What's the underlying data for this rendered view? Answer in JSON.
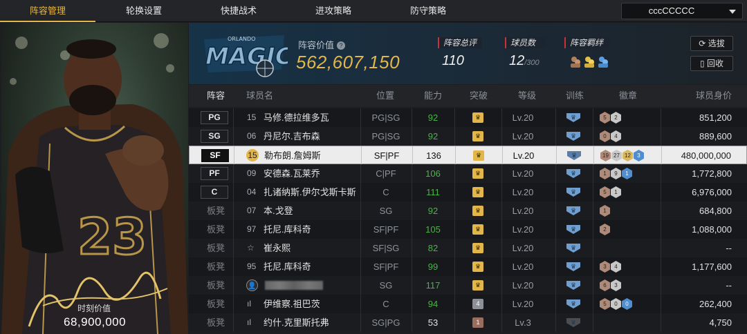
{
  "nav": {
    "tabs": [
      "阵容管理",
      "轮换设置",
      "快捷战术",
      "进攻策略",
      "防守策略"
    ],
    "active_index": 0,
    "lineup_select": "cccCCCCC"
  },
  "card": {
    "jersey_number": "23",
    "value_label": "时刻价值",
    "value": "68,900,000"
  },
  "header": {
    "team_logo": "magic-logo",
    "lineup_value_label": "阵容价值",
    "lineup_value": "562,607,150",
    "total_rating_label": "阵容总评",
    "total_rating": "110",
    "player_count_label": "球员数",
    "player_count": "12",
    "player_count_max": "/300",
    "chemistry_label": "阵容羁绊",
    "select_button": "选拔",
    "recycle_button": "回收"
  },
  "table": {
    "headers": [
      "阵容",
      "球员名",
      "位置",
      "能力",
      "突破",
      "等级",
      "训练",
      "徽章",
      "球员身价"
    ],
    "rows": [
      {
        "slot": "PG",
        "starter": true,
        "num": "15",
        "name": "马修.德拉维多瓦",
        "position": "PG|SG",
        "rating": "92",
        "rating_color": "#4cb34c",
        "break": "crown",
        "break_color": "#e3b64a",
        "level": "Lv.20",
        "badges": [
          [
            "5",
            "b-bronze"
          ],
          [
            "2",
            "b-silver"
          ]
        ],
        "value": "851,200"
      },
      {
        "slot": "SG",
        "starter": true,
        "num": "06",
        "name": "丹尼尔.吉布森",
        "position": "PG|SG",
        "rating": "92",
        "rating_color": "#4cb34c",
        "break": "crown",
        "break_color": "#e3b64a",
        "level": "Lv.20",
        "badges": [
          [
            "0",
            "b-bronze"
          ],
          [
            "4",
            "b-silver"
          ]
        ],
        "value": "889,600"
      },
      {
        "slot": "SF",
        "starter": true,
        "selected": true,
        "num": "15",
        "name": "勒布朗.詹姆斯",
        "position": "SF|PF",
        "rating": "136",
        "rating_color": "#111111",
        "break": "crown",
        "break_color": "#e3b64a",
        "level": "Lv.20",
        "badges": [
          [
            "19",
            "b-bronze"
          ],
          [
            "27",
            "b-silver"
          ],
          [
            "12",
            "b-gold"
          ],
          [
            "3",
            "b-blue"
          ]
        ],
        "value": "480,000,000"
      },
      {
        "slot": "PF",
        "starter": true,
        "num": "09",
        "name": "安德森.瓦莱乔",
        "position": "C|PF",
        "rating": "106",
        "rating_color": "#4cb34c",
        "break": "crown",
        "break_color": "#e3b64a",
        "level": "Lv.20",
        "badges": [
          [
            "1",
            "b-bronze"
          ],
          [
            "9",
            "b-silver"
          ],
          [
            "1",
            "b-blue"
          ]
        ],
        "value": "1,772,800"
      },
      {
        "slot": "C",
        "starter": true,
        "num": "04",
        "name": "扎诸纳斯.伊尔戈斯卡斯",
        "position": "C",
        "rating": "111",
        "rating_color": "#4cb34c",
        "break": "crown",
        "break_color": "#e3b64a",
        "level": "Lv.20",
        "badges": [
          [
            "5",
            "b-bronze"
          ],
          [
            "1",
            "b-silver"
          ]
        ],
        "value": "6,976,000"
      },
      {
        "slot": "板凳",
        "starter": false,
        "num": "07",
        "name": "本.戈登",
        "position": "SG",
        "rating": "92",
        "rating_color": "#4cb34c",
        "break": "crown",
        "break_color": "#e3b64a",
        "level": "Lv.20",
        "badges": [
          [
            "1",
            "b-bronze"
          ]
        ],
        "value": "684,800"
      },
      {
        "slot": "板凳",
        "starter": false,
        "num": "97",
        "name": "托尼.库科奇",
        "position": "SF|PF",
        "rating": "105",
        "rating_color": "#4cb34c",
        "break": "crown",
        "break_color": "#e3b64a",
        "level": "Lv.20",
        "badges": [
          [
            "2",
            "b-bronze"
          ]
        ],
        "value": "1,088,000"
      },
      {
        "slot": "板凳",
        "starter": false,
        "num": "☆",
        "name": "崔永熙",
        "position": "SF|SG",
        "rating": "82",
        "rating_color": "#4cb34c",
        "break": "crown",
        "break_color": "#e3b64a",
        "level": "Lv.20",
        "badges": [],
        "value": "--"
      },
      {
        "slot": "板凳",
        "starter": false,
        "num": "95",
        "name": "托尼.库科奇",
        "position": "SF|PF",
        "rating": "99",
        "rating_color": "#4cb34c",
        "break": "crown",
        "break_color": "#e3b64a",
        "level": "Lv.20",
        "badges": [
          [
            "3",
            "b-bronze"
          ],
          [
            "4",
            "b-silver"
          ]
        ],
        "value": "1,177,600"
      },
      {
        "slot": "板凳",
        "starter": false,
        "num": "",
        "name": "",
        "position": "SG",
        "rating": "117",
        "rating_color": "#4cb34c",
        "break": "crown",
        "break_color": "#e3b64a",
        "level": "Lv.20",
        "badges": [
          [
            "6",
            "b-bronze"
          ],
          [
            "3",
            "b-silver"
          ]
        ],
        "value": "--"
      },
      {
        "slot": "板凳",
        "starter": false,
        "num": "ıl",
        "name": "伊维察.祖巴茨",
        "position": "C",
        "rating": "94",
        "rating_color": "#4cb34c",
        "break": "4",
        "break_color": "#8d9096",
        "level": "Lv.20",
        "badges": [
          [
            "5",
            "b-bronze"
          ],
          [
            "0",
            "b-silver"
          ],
          [
            "0",
            "b-blue"
          ]
        ],
        "value": "262,400"
      },
      {
        "slot": "板凳",
        "starter": false,
        "num": "ıl",
        "name": "约什.克里斯托弗",
        "position": "SG|PG",
        "rating": "53",
        "rating_color": "#e2e2e2",
        "break": "1",
        "break_color": "#9a6e5e",
        "level": "Lv.3",
        "badges": [],
        "value": "4,750"
      }
    ]
  }
}
